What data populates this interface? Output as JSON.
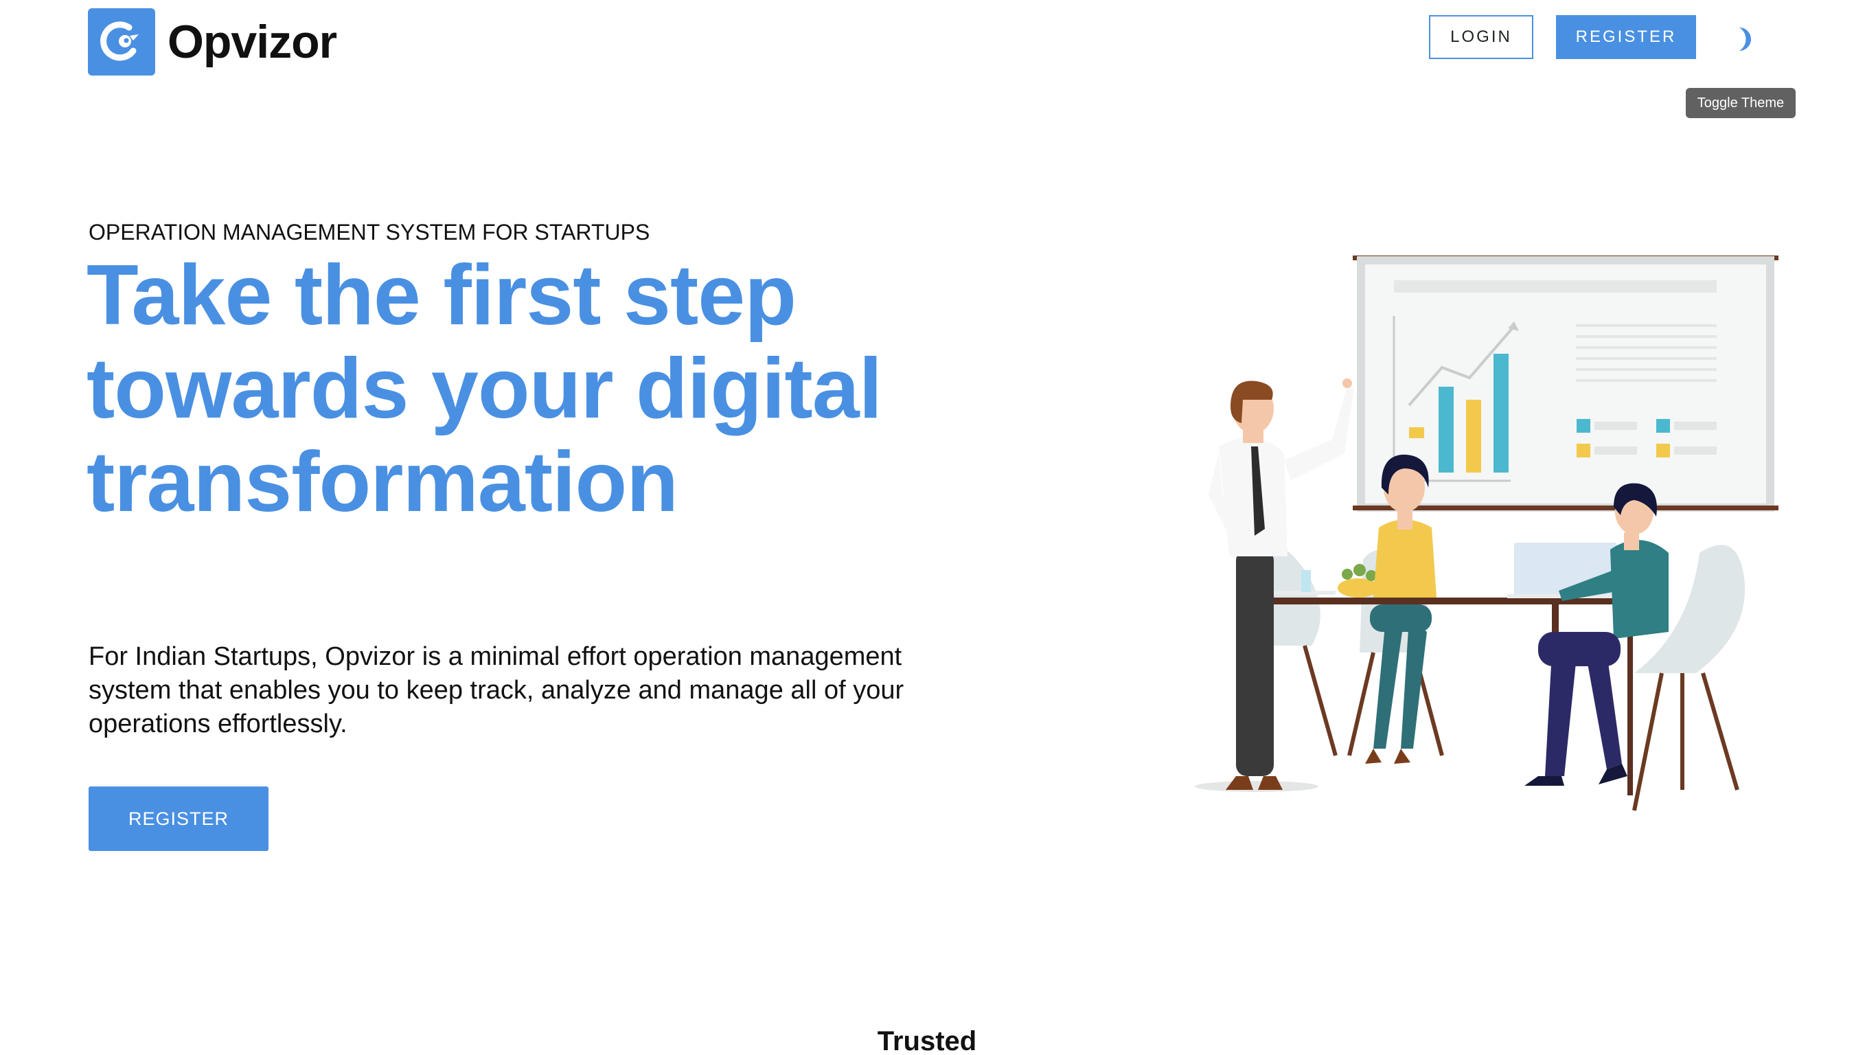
{
  "brand": {
    "name": "Opvizor",
    "accent_color": "#4a90e2"
  },
  "header": {
    "login_label": "LOGIN",
    "register_label": "REGISTER",
    "theme_icon": "moon-icon",
    "tooltip": "Toggle Theme"
  },
  "hero": {
    "eyebrow": "OPERATION MANAGEMENT SYSTEM FOR STARTUPS",
    "headline": "Take the first step towards your digital transformation",
    "description": "For Indian Startups, Opvizor is a minimal effort operation management system that enables you to keep track, analyze and manage all of your operations effortlessly.",
    "cta_label": "REGISTER"
  },
  "trusted_by": {
    "heading": "Trusted By"
  },
  "illustration": {
    "name": "team-meeting-illustration"
  }
}
